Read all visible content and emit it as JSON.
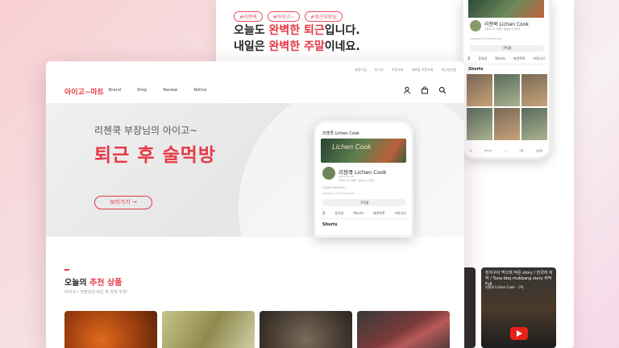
{
  "back": {
    "tags": [
      "#리첸쿡",
      "#아이고~",
      "#퇴근부장님"
    ],
    "headline_line1_a": "오늘도 ",
    "headline_line1_red": "완벽한 퇴근",
    "headline_line1_b": "입니다.",
    "headline_line2_a": "내일은 ",
    "headline_line2_red": "완벽한 주말",
    "headline_line2_b": "이네요."
  },
  "phone_back": {
    "channel_name": "리첸쿡 Lichen Cook",
    "subs": "구독자 24.1만명 · 동영상 1.1천개",
    "link": "instagram.com/lichencook",
    "subscribe": "구독중",
    "tabs": [
      "홈",
      "동영상",
      "Shorts",
      "재생목록",
      "커뮤니티"
    ],
    "shorts_label": "Shorts",
    "nav": [
      "홈",
      "Shorts",
      "+",
      "구독",
      "보관함"
    ]
  },
  "shorts_card": {
    "text": "한치구이 먹으며 적은 story / 한국어 자막 / Tuna bbq mukbang story 자막Full",
    "channel": "리첸쿡 Lichen Cook · 구독"
  },
  "front": {
    "util_links": [
      "회원가입",
      "로그인",
      "주문조회",
      "비회원 주문조회",
      "최근본상품"
    ],
    "logo": "아이고~마트",
    "nav": [
      "Brand",
      "Shop",
      "Review",
      "Notice"
    ],
    "icons": [
      "user-icon",
      "cart-icon",
      "search-icon"
    ],
    "hero_sub": "리첸쿡 부장님의 아이고~",
    "hero_title": "퇴근 후 술먹방",
    "hero_button": "보러가기 →"
  },
  "phone_front": {
    "header": "리첸쿡 Lichen Cook",
    "banner_text": "Lichen Cook",
    "name": "리첸쿡 Lichen Cook",
    "handle": "@lichencook",
    "stats": "구독자 24.1만명 · 동영상 1.1천개",
    "desc": "집 앞에서 매일 술먹방 >",
    "link": "instagram.com/lichencook",
    "subscribe": "구독중",
    "tabs": [
      "홈",
      "동영상",
      "Shorts",
      "재생목록",
      "커뮤니티"
    ],
    "shorts_label": "Shorts"
  },
  "section": {
    "title_a": "오늘의 ",
    "title_red": "추천 상품",
    "subtitle": "아이고~ 부장님의 퇴근 후 강력 추천!"
  },
  "accent": "#e63946"
}
